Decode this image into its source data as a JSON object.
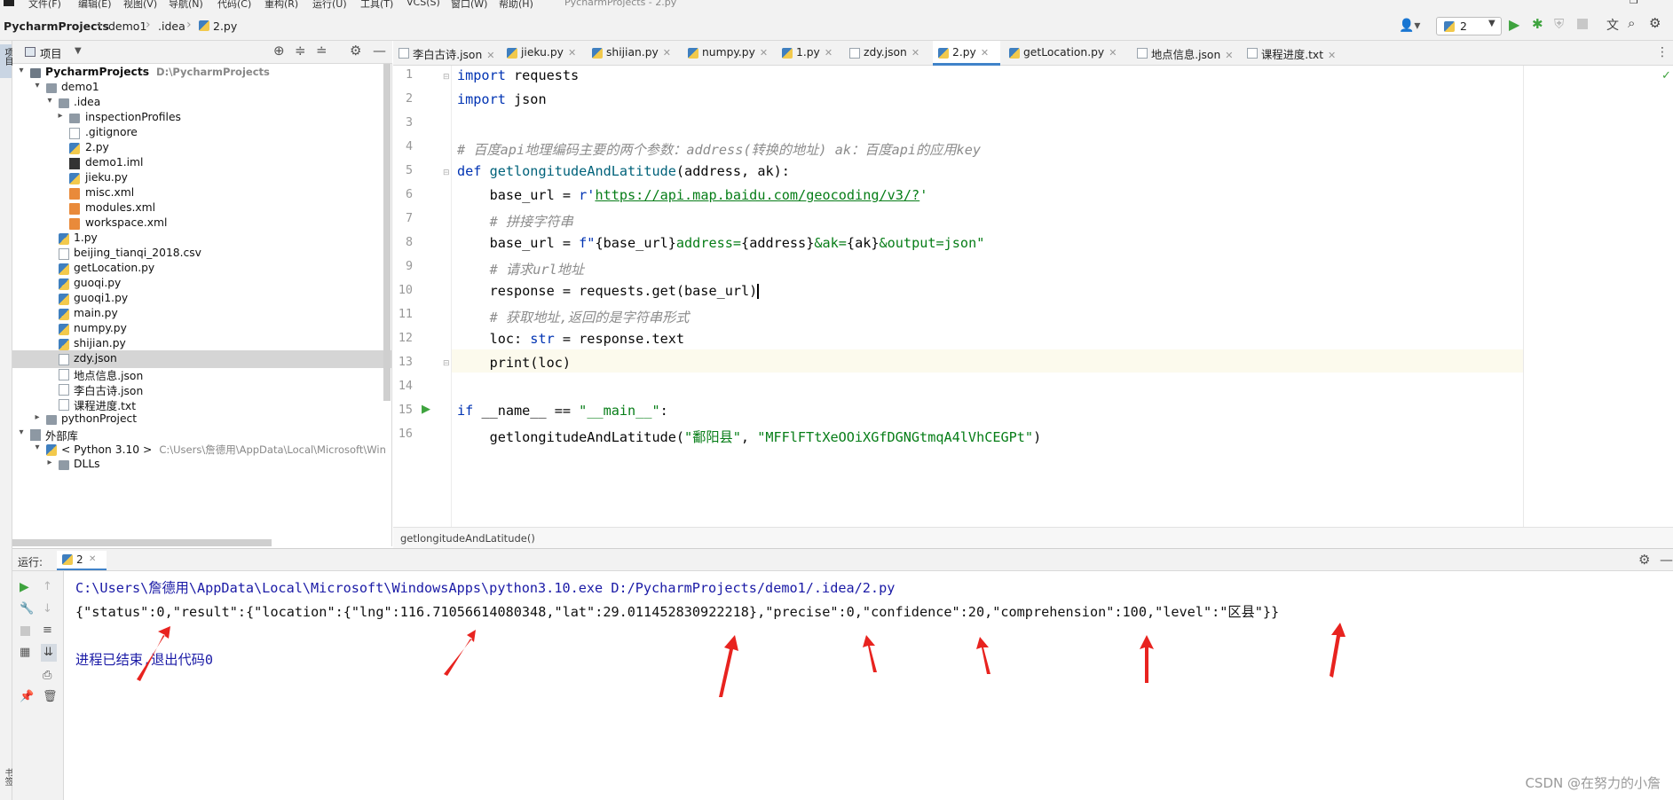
{
  "menu": {
    "items": [
      "文件(F)",
      "编辑(E)",
      "视图(V)",
      "导航(N)",
      "代码(C)",
      "重构(R)",
      "运行(U)",
      "工具(T)",
      "VCS(S)",
      "窗口(W)",
      "帮助(H)"
    ],
    "title": "PycharmProjects - 2.py"
  },
  "breadcrumb": {
    "project": "PycharmProjects",
    "folder1": "demo1",
    "folder2": ".idea",
    "file": "2.py"
  },
  "toolbar": {
    "run_config": "2"
  },
  "project_panel": {
    "title": "项目"
  },
  "tree": [
    {
      "label": "PycharmProjects",
      "hint": "D:\\PycharmProjects",
      "arrow": "▾",
      "kind": "proj"
    },
    {
      "label": "demo1",
      "arrow": "▾",
      "kind": "folder"
    },
    {
      "label": ".idea",
      "arrow": "▾",
      "kind": "folder"
    },
    {
      "label": "inspectionProfiles",
      "arrow": "▸",
      "kind": "folder"
    },
    {
      "label": ".gitignore",
      "kind": "file"
    },
    {
      "label": "2.py",
      "kind": "py"
    },
    {
      "label": "demo1.iml",
      "kind": "file"
    },
    {
      "label": "jieku.py",
      "kind": "py"
    },
    {
      "label": "misc.xml",
      "kind": "xml"
    },
    {
      "label": "modules.xml",
      "kind": "xml"
    },
    {
      "label": "workspace.xml",
      "kind": "xml"
    },
    {
      "label": "1.py",
      "kind": "py"
    },
    {
      "label": "beijing_tianqi_2018.csv",
      "kind": "file"
    },
    {
      "label": "getLocation.py",
      "kind": "py"
    },
    {
      "label": "guoqi.py",
      "kind": "py"
    },
    {
      "label": "guoqi1.py",
      "kind": "py"
    },
    {
      "label": "main.py",
      "kind": "py"
    },
    {
      "label": "numpy.py",
      "kind": "py"
    },
    {
      "label": "shijian.py",
      "kind": "py"
    },
    {
      "label": "zdy.json",
      "kind": "json",
      "selected": true
    },
    {
      "label": "地点信息.json",
      "kind": "json"
    },
    {
      "label": "李白古诗.json",
      "kind": "json"
    },
    {
      "label": "课程进度.txt",
      "kind": "txt"
    },
    {
      "label": "pythonProject",
      "arrow": "▸",
      "kind": "folder"
    },
    {
      "label": "外部库",
      "arrow": "▾",
      "kind": "lib"
    },
    {
      "label": "< Python 3.10 >",
      "hint": "C:\\Users\\詹德用\\AppData\\Local\\Microsoft\\Win",
      "arrow": "▾",
      "kind": "py"
    },
    {
      "label": "DLLs",
      "arrow": "▸",
      "kind": "folder"
    }
  ],
  "tabs": [
    {
      "label": "李白古诗.json",
      "kind": "json"
    },
    {
      "label": "jieku.py",
      "kind": "py"
    },
    {
      "label": "shijian.py",
      "kind": "py"
    },
    {
      "label": "numpy.py",
      "kind": "py"
    },
    {
      "label": "1.py",
      "kind": "py"
    },
    {
      "label": "zdy.json",
      "kind": "json"
    },
    {
      "label": "2.py",
      "kind": "py",
      "active": true
    },
    {
      "label": "getLocation.py",
      "kind": "py"
    },
    {
      "label": "地点信息.json",
      "kind": "json"
    },
    {
      "label": "课程进度.txt",
      "kind": "txt"
    }
  ],
  "editor": {
    "line_numbers": [
      "1",
      "2",
      "3",
      "4",
      "5",
      "6",
      "7",
      "8",
      "9",
      "10",
      "11",
      "12",
      "13",
      "14",
      "15",
      "16"
    ],
    "current_line": "10",
    "lines": {
      "l1_kw": "import",
      "l1_rest": " requests",
      "l2_kw": "import",
      "l2_rest": " json",
      "l4_comment": "# 百度api地理编码主要的两个参数：address(转换的地址) ak：百度api的应用key",
      "l5_kw": "def",
      "l5_fn": "getlongitudeAndLatitude",
      "l5_rest": "(address, ak):",
      "l6_a": "    base_url = ",
      "l6_b": "r'",
      "l6_url": "https://api.map.baidu.com/geocoding/v3/?",
      "l6_c": "'",
      "l7_comment": "    # 拼接字符串",
      "l8_a": "    base_url = ",
      "l8_b": "f\"",
      "l8_c": "{base_url}",
      "l8_d": "address=",
      "l8_e": "{address}",
      "l8_f": "&ak=",
      "l8_g": "{ak}",
      "l8_h": "&output=json\"",
      "l9_comment": "    # 请求url地址",
      "l10": "    response = requests.get(base_url)",
      "l11_comment": "    # 获取地址,返回的是字符串形式",
      "l12_a": "    loc: ",
      "l12_b": "str",
      "l12_c": " = response.text",
      "l13": "    print(loc)",
      "l15_kw": "if",
      "l15_a": " __name__ == ",
      "l15_str": "\"__main__\"",
      "l15_c": ":",
      "l16_a": "    getlongitudeAndLatitude(",
      "l16_s1": "\"鄱阳县\"",
      "l16_b": ", ",
      "l16_s2": "\"MFFlFTtXeOOiXGfDGNGtmqA4lVhCEGPt\"",
      "l16_c": ")"
    },
    "structure_crumb": "getlongitudeAndLatitude()"
  },
  "run": {
    "label": "运行:",
    "tab": "2",
    "cmd": "C:\\Users\\詹德用\\AppData\\Local\\Microsoft\\WindowsApps\\python3.10.exe D:/PycharmProjects/demo1/.idea/2.py",
    "output": "{\"status\":0,\"result\":{\"location\":{\"lng\":116.71056614080348,\"lat\":29.011452830922218},\"precise\":0,\"confidence\":20,\"comprehension\":100,\"level\":\"区县\"}}",
    "exit": "进程已结束,退出代码0"
  },
  "side": {
    "left_top": "项目",
    "left_bottom": "书签"
  },
  "watermark": "CSDN @在努力的小詹",
  "colors": {
    "accent": "#4083c9",
    "arrow_red": "#e8231f",
    "run_green": "#3ea33e"
  }
}
